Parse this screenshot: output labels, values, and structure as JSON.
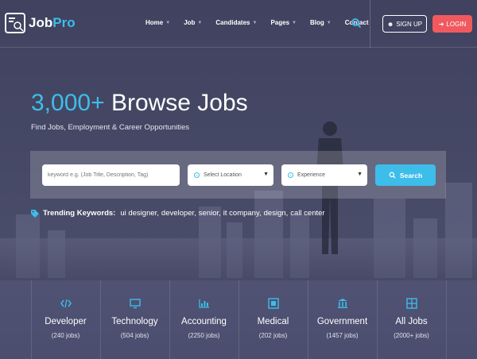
{
  "brand": {
    "name_part1": "Job",
    "name_part2": "Pro"
  },
  "nav": {
    "items": [
      {
        "label": "Home",
        "has_dropdown": true
      },
      {
        "label": "Job",
        "has_dropdown": true
      },
      {
        "label": "Candidates",
        "has_dropdown": true
      },
      {
        "label": "Pages",
        "has_dropdown": true
      },
      {
        "label": "Blog",
        "has_dropdown": true
      },
      {
        "label": "Contact",
        "has_dropdown": false
      }
    ],
    "search_icon": "search-icon"
  },
  "auth": {
    "signup_label": "SIGN UP",
    "login_label": "LOGIN"
  },
  "hero": {
    "count": "3,000+",
    "title": "Browse Jobs",
    "subtitle": "Find Jobs, Employment & Career Opportunities"
  },
  "search": {
    "keyword_placeholder": "keyword e.g. (Job Title, Description, Tag)",
    "location_placeholder": "Select Location",
    "experience_placeholder": "Experience",
    "button_label": "Search"
  },
  "trending": {
    "label": "Trending Keywords:",
    "keywords": [
      "ui designer,",
      "developer,",
      "senior,",
      "it company,",
      "design,",
      "call center"
    ]
  },
  "categories": [
    {
      "name": "Developer",
      "count": "(240 jobs)",
      "icon": "code-icon"
    },
    {
      "name": "Technology",
      "count": "(504 jobs)",
      "icon": "monitor-icon"
    },
    {
      "name": "Accounting",
      "count": "(2250 jobs)",
      "icon": "bar-chart-icon"
    },
    {
      "name": "Medical",
      "count": "(202 jobs)",
      "icon": "medical-icon"
    },
    {
      "name": "Government",
      "count": "(1457 jobs)",
      "icon": "institution-icon"
    },
    {
      "name": "All Jobs",
      "count": "(2000+ jobs)",
      "icon": "grid-icon"
    }
  ],
  "colors": {
    "accent": "#3dbde9",
    "login": "#f05a5e",
    "background": "#3e4060"
  }
}
